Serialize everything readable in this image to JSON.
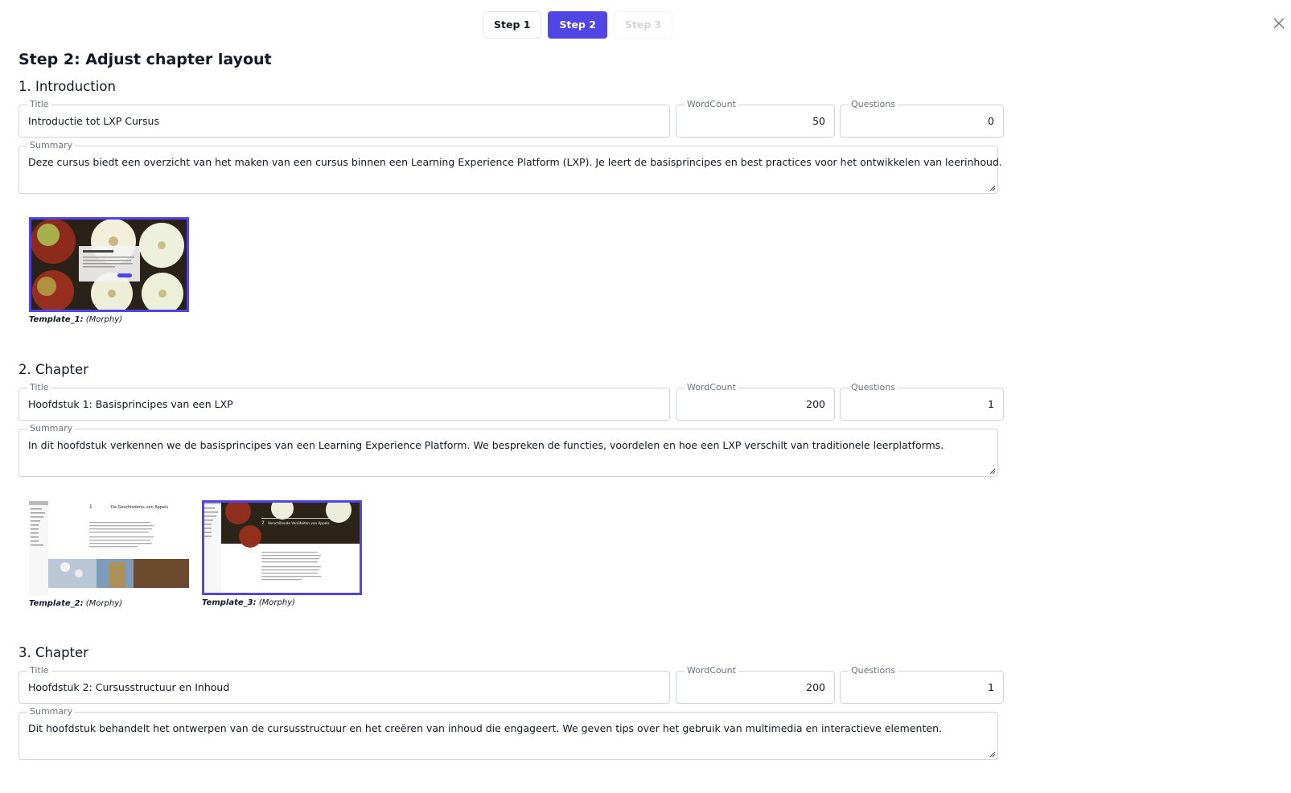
{
  "steps": [
    {
      "label": "Step 1",
      "state": "default"
    },
    {
      "label": "Step 2",
      "state": "active"
    },
    {
      "label": "Step 3",
      "state": "disabled"
    }
  ],
  "close_icon": "close-icon",
  "page_title": "Step 2: Adjust chapter layout",
  "field_labels": {
    "title": "Title",
    "wordcount": "WordCount",
    "questions": "Questions",
    "summary": "Summary"
  },
  "sections": [
    {
      "heading": "1. Introduction",
      "title": "Introductie tot LXP Cursus",
      "wordcount": "50",
      "questions": "0",
      "summary": "Deze cursus biedt een overzicht van het maken van een cursus binnen een Learning Experience Platform (LXP). Je leert de basisprincipes en best practices voor het ontwikkelen van leerinhoud.",
      "templates": [
        {
          "name": "Template_1:",
          "engine": "(Morphy)",
          "selected": true,
          "preview": "apples-with-dialog"
        }
      ]
    },
    {
      "heading": "2. Chapter",
      "title": "Hoofdstuk 1: Basisprincipes van een LXP",
      "wordcount": "200",
      "questions": "1",
      "summary": "In dit hoofdstuk verkennen we de basisprincipes van een Learning Experience Platform. We bespreken de functies, voordelen en hoe een LXP verschilt van traditionele leerplatforms.",
      "templates": [
        {
          "name": "Template_2:",
          "engine": "(Morphy)",
          "selected": false,
          "preview": "text-page-with-image",
          "preview_number": "1",
          "preview_heading": "De Geschiedenis van Appels"
        },
        {
          "name": "Template_3:",
          "engine": "(Morphy)",
          "selected": true,
          "preview": "banner-page",
          "preview_number": "2",
          "preview_heading": "Verschillende Variëteiten van Appels"
        }
      ]
    },
    {
      "heading": "3. Chapter",
      "title": "Hoofdstuk 2: Cursusstructuur en Inhoud",
      "wordcount": "200",
      "questions": "1",
      "summary": "Dit hoofdstuk behandelt het ontwerpen van de cursusstructuur en het creëren van inhoud die engageert. We geven tips over het gebruik van multimedia en interactieve elementen.",
      "templates": []
    }
  ],
  "colors": {
    "accent": "#4f46e5",
    "border": "#d1d5db",
    "label": "#6b7280"
  }
}
